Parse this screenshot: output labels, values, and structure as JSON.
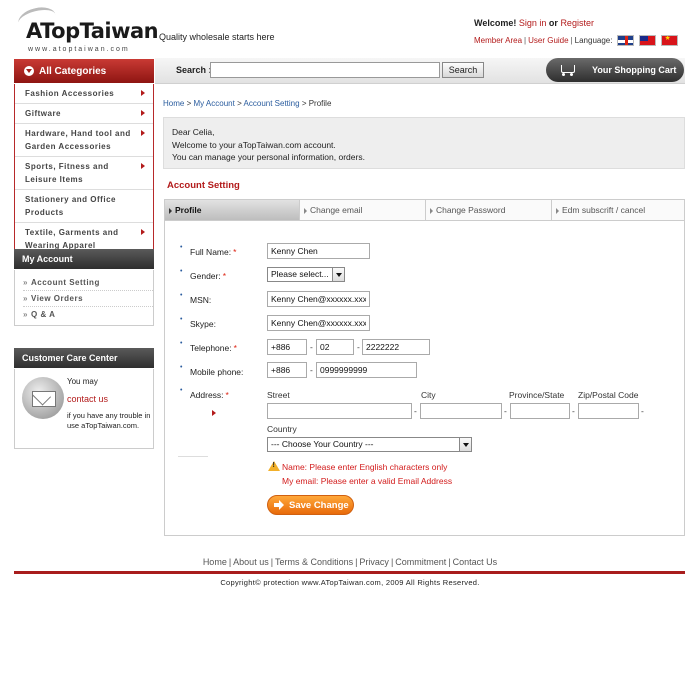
{
  "header": {
    "logo_text": "ATopTaiwan",
    "logo_sub": "www.atoptaiwan.com",
    "tagline": "Quality wholesale starts here",
    "welcome_prefix": "Welcome!",
    "sign_in": "Sign in",
    "or": "or",
    "register": "Register",
    "member_area": "Member Area",
    "user_guide": "User Guide",
    "language_label": "Language:",
    "flags": [
      "english-flag",
      "taiwan-flag",
      "china-flag"
    ]
  },
  "search": {
    "label": "Search :",
    "value": "",
    "button": "Search"
  },
  "cart": {
    "label": "Your Shopping Cart"
  },
  "sidebar": {
    "categories_title": "All Categories",
    "categories": [
      "Fashion Accessories",
      "Giftware",
      "Hardware, Hand tool and Garden Accessories",
      "Sports, Fitness and Leisure Items",
      "Stationery and Office Products",
      "Textile, Garments and Wearing Apparel"
    ],
    "account_title": "My Account",
    "account_items": [
      "Account Setting",
      "View Orders",
      "Q & A"
    ],
    "care_title": "Customer Care Center",
    "care_you_may": "You may",
    "care_contact": "contact us",
    "care_text": "if you have any trouble in use aTopTaiwan.com."
  },
  "breadcrumb": {
    "items": [
      "Home",
      "My Account",
      "Account Setting"
    ],
    "current": "Profile",
    "separator": ">"
  },
  "welcome_box": {
    "line1": "Dear Celia,",
    "line2": "Welcome to your aTopTaiwan.com account.",
    "line3": "You can manage your personal information, orders."
  },
  "account_setting": {
    "title": "Account Setting",
    "tabs": [
      "Profile",
      "Change email",
      "Change Password",
      "Edm subscrift / cancel"
    ],
    "active_tab": 0
  },
  "form": {
    "full_name": {
      "label": "Full Name:",
      "required": true,
      "value": "Kenny Chen"
    },
    "gender": {
      "label": "Gender:",
      "required": true,
      "value": "Please select..."
    },
    "msn": {
      "label": "MSN:",
      "required": false,
      "value": "Kenny Chen@xxxxxx.xxx"
    },
    "skype": {
      "label": "Skype:",
      "required": false,
      "value": "Kenny Chen@xxxxxx.xxx"
    },
    "telephone": {
      "label": "Telephone:",
      "required": true,
      "country_code": "+886",
      "area_code": "02",
      "number": "2222222"
    },
    "mobile": {
      "label": "Mobile phone:",
      "required": false,
      "country_code": "+886",
      "number": "0999999999"
    },
    "address": {
      "label": "Address:",
      "required": true,
      "street_label": "Street",
      "city_label": "City",
      "province_label": "Province/State",
      "zip_label": "Zip/Postal Code",
      "country_label": "Country",
      "country_value": "--- Choose Your Country ---",
      "street": "",
      "city": "",
      "province": "",
      "zip": ""
    },
    "required_marker": "*",
    "dash": "-",
    "errors": [
      "Name: Please enter English characters only",
      "My email: Please enter a valid Email Address"
    ],
    "save_button": "Save Change"
  },
  "footer": {
    "links": [
      "Home",
      "About us",
      "Terms & Conditions",
      "Privacy",
      "Commitment",
      "Contact Us"
    ],
    "separator": "|",
    "copyright": "Copyright© protection www.ATopTaiwan.com, 2009 All Rights Reserved."
  },
  "colors": {
    "brand_red": "#b31b1b",
    "link_blue": "#2a5c9e",
    "save_orange": "#f08a1c"
  }
}
